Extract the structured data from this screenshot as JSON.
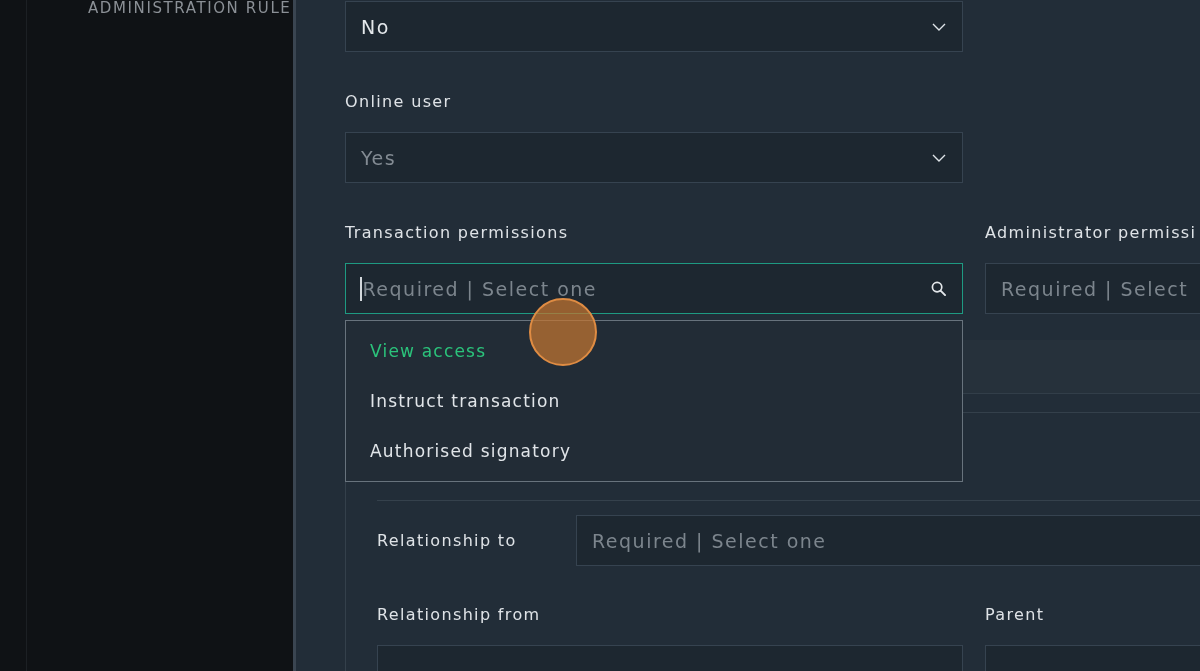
{
  "sidebar": {
    "heading": "ADMINISTRATION RULE"
  },
  "fields": [
    {
      "kind": "select",
      "value": "No",
      "disabled": false
    },
    {
      "kind": "select",
      "label": "Online user",
      "value": "Yes",
      "disabled": true
    }
  ],
  "permissions": [
    {
      "label": "Transaction permissions",
      "placeholder": "Required | Select one",
      "focused": true
    },
    {
      "label": "Administrator permissi",
      "placeholder": "Required | Select",
      "focused": false
    }
  ],
  "dropdown": {
    "options": [
      {
        "label": "View access",
        "selected": true
      },
      {
        "label": "Instruct transaction",
        "selected": false
      },
      {
        "label": "Authorised signatory",
        "selected": false
      }
    ]
  },
  "relationships": {
    "rows": [
      {
        "label": "Relationship to",
        "placeholder": "Required | Select one"
      }
    ],
    "fields": [
      {
        "label": "Relationship from"
      },
      {
        "label": "Parent"
      }
    ]
  }
}
